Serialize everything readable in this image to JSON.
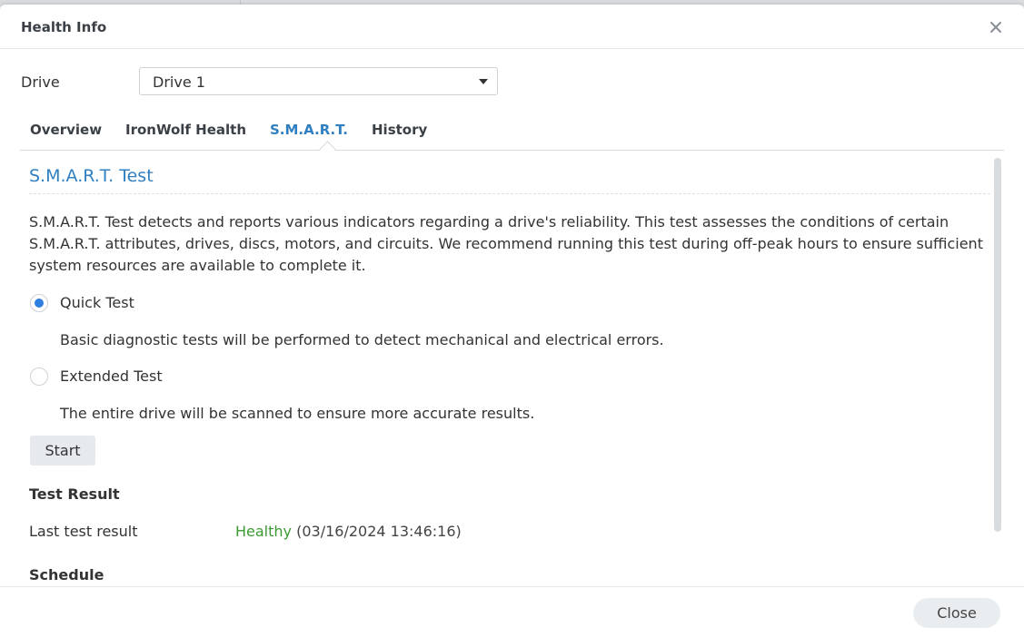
{
  "dialog": {
    "title": "Health Info",
    "close_icon": "close-icon"
  },
  "drive": {
    "label": "Drive",
    "selected": "Drive 1"
  },
  "tabs": [
    {
      "label": "Overview",
      "active": false
    },
    {
      "label": "IronWolf Health",
      "active": false
    },
    {
      "label": "S.M.A.R.T.",
      "active": true
    },
    {
      "label": "History",
      "active": false
    }
  ],
  "smart": {
    "title": "S.M.A.R.T. Test",
    "description": "S.M.A.R.T. Test detects and reports various indicators regarding a drive's reliability. This test assesses the conditions of certain S.M.A.R.T. attributes, drives, discs, motors, and circuits. We recommend running this test during off-peak hours to ensure sufficient system resources are available to complete it.",
    "options": [
      {
        "label": "Quick Test",
        "description": "Basic diagnostic tests will be performed to detect mechanical and electrical errors.",
        "checked": true
      },
      {
        "label": "Extended Test",
        "description": "The entire drive will be scanned to ensure more accurate results.",
        "checked": false
      }
    ],
    "start_label": "Start"
  },
  "test_result": {
    "heading": "Test Result",
    "last_label": "Last test result",
    "status": "Healthy",
    "timestamp": "(03/16/2024 13:46:16)"
  },
  "schedule": {
    "heading": "Schedule"
  },
  "footer": {
    "close_label": "Close"
  },
  "colors": {
    "accent": "#2f7fc1",
    "healthy": "#3c9a32",
    "radio_checked": "#2f7fe0"
  }
}
